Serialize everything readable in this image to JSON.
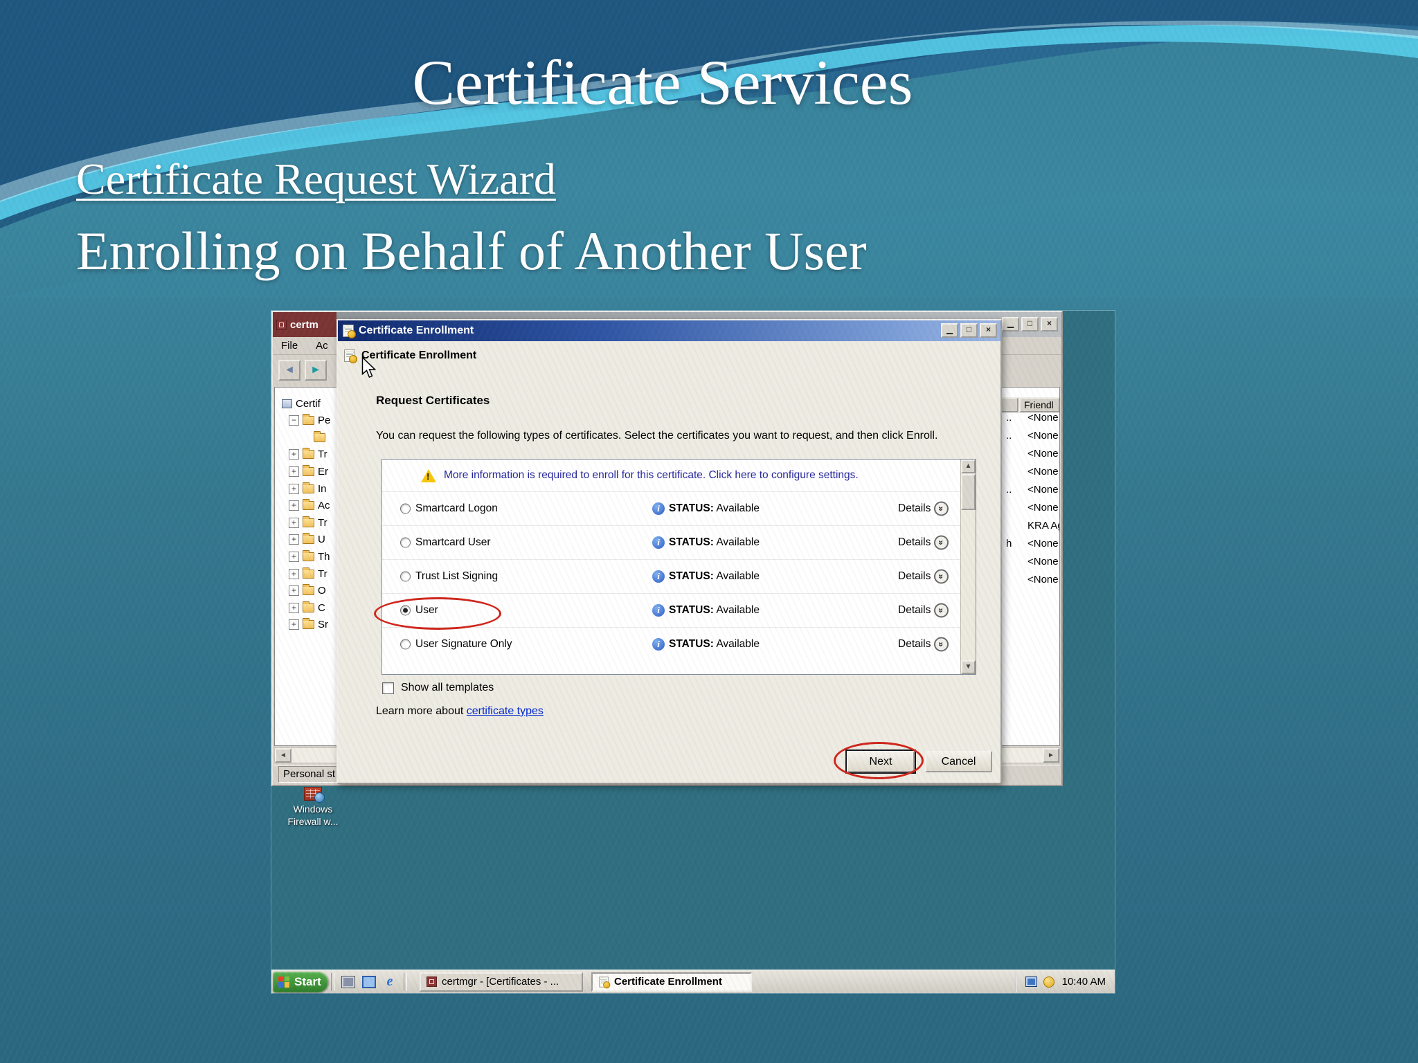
{
  "slide": {
    "title": "Certificate Services",
    "subtitle": "Certificate Request Wizard",
    "heading": "Enrolling on Behalf of Another User"
  },
  "icons": {
    "minimize": "▁",
    "maximize": "□",
    "close": "×",
    "back": "◄",
    "forward": "►",
    "scroll_up": "▲",
    "scroll_down": "▼",
    "scroll_left": "◄",
    "scroll_right": "►",
    "chevron_down": "»",
    "info": "i",
    "ie": "e"
  },
  "mmc": {
    "window_title": "certm",
    "menu": [
      "File",
      "Ac"
    ],
    "tree": [
      {
        "label": "Certif",
        "type": "root"
      },
      {
        "label": "Pe",
        "type": "minus"
      },
      {
        "label": "",
        "type": "child"
      },
      {
        "label": "Tr",
        "type": "plus"
      },
      {
        "label": "Er",
        "type": "plus"
      },
      {
        "label": "In",
        "type": "plus"
      },
      {
        "label": "Ac",
        "type": "plus"
      },
      {
        "label": "Tr",
        "type": "plus"
      },
      {
        "label": "U",
        "type": "plus"
      },
      {
        "label": "Th",
        "type": "plus"
      },
      {
        "label": "Tr",
        "type": "plus"
      },
      {
        "label": "O",
        "type": "plus"
      },
      {
        "label": "C",
        "type": "plus"
      },
      {
        "label": "Sr",
        "type": "plus"
      }
    ],
    "list": {
      "header": "Friendl",
      "rows": [
        {
          "frag": "..",
          "value": "<None"
        },
        {
          "frag": "..",
          "value": "<None"
        },
        {
          "frag": "",
          "value": "<None"
        },
        {
          "frag": "",
          "value": "<None"
        },
        {
          "frag": "..",
          "value": "<None"
        },
        {
          "frag": "",
          "value": "<None"
        },
        {
          "frag": "",
          "value": "KRA Ag"
        },
        {
          "frag": "h",
          "value": "<None"
        },
        {
          "frag": "",
          "value": "<None"
        },
        {
          "frag": "",
          "value": "<None"
        }
      ]
    },
    "status_text": "Personal st"
  },
  "dialog": {
    "title": "Certificate Enrollment",
    "header": "Certificate Enrollment",
    "section_title": "Request Certificates",
    "description": "You can request the following types of certificates. Select the certificates you want to request, and then click Enroll.",
    "warning_text": "More information is required to enroll for this certificate. Click here to configure settings.",
    "certs": [
      {
        "name": "Smartcard Logon",
        "status_label": "STATUS:",
        "status": "Available",
        "details": "Details",
        "selected": false
      },
      {
        "name": "Smartcard User",
        "status_label": "STATUS:",
        "status": "Available",
        "details": "Details",
        "selected": false
      },
      {
        "name": "Trust List Signing",
        "status_label": "STATUS:",
        "status": "Available",
        "details": "Details",
        "selected": false
      },
      {
        "name": "User",
        "status_label": "STATUS:",
        "status": "Available",
        "details": "Details",
        "selected": true
      },
      {
        "name": "User Signature Only",
        "status_label": "STATUS:",
        "status": "Available",
        "details": "Details",
        "selected": false
      }
    ],
    "show_all_label": "Show all templates",
    "learn_more_prefix": "Learn more about ",
    "learn_more_link": "certificate types",
    "next_label": "Next",
    "cancel_label": "Cancel"
  },
  "desktop": {
    "icon_label_line1": "Windows",
    "icon_label_line2": "Firewall w...",
    "taskbar": {
      "start_label": "Start",
      "task1": "certmgr - [Certificates - ...",
      "task2": "Certificate Enrollment",
      "time": "10:40 AM"
    }
  },
  "colors": {
    "annotation_red": "#d0261c",
    "link_blue": "#0026cc",
    "warning_text_blue": "#26279b"
  }
}
